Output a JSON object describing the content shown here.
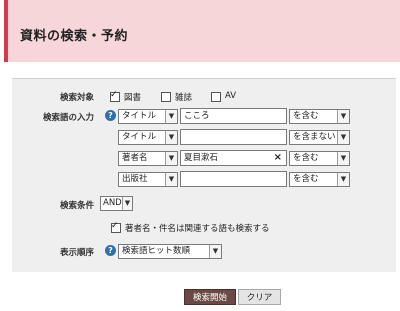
{
  "header": {
    "title": "資料の検索・予約"
  },
  "form": {
    "target": {
      "label": "検索対象",
      "options": [
        {
          "label": "図書",
          "checked": true
        },
        {
          "label": "雑誌",
          "checked": false
        },
        {
          "label": "AV",
          "checked": false
        }
      ]
    },
    "terms": {
      "label": "検索語の入力",
      "help_icon": "help-icon",
      "rows": [
        {
          "field": "タイトル",
          "value": "こころ",
          "condition": "を含む"
        },
        {
          "field": "タイトル",
          "value": "",
          "condition": "を含まない"
        },
        {
          "field": "著者名",
          "value": "夏目漱石",
          "condition": "を含む",
          "clear_icon": "×"
        },
        {
          "field": "出版社",
          "value": "",
          "condition": "を含む"
        }
      ]
    },
    "condition": {
      "label": "検索条件",
      "operator": "AND",
      "related_terms": {
        "label": "著者名・件名は関連する語も検索する",
        "checked": true
      }
    },
    "order": {
      "label": "表示順序",
      "value": "検索語ヒット数順"
    }
  },
  "buttons": {
    "search": "検索開始",
    "clear": "クリア"
  }
}
